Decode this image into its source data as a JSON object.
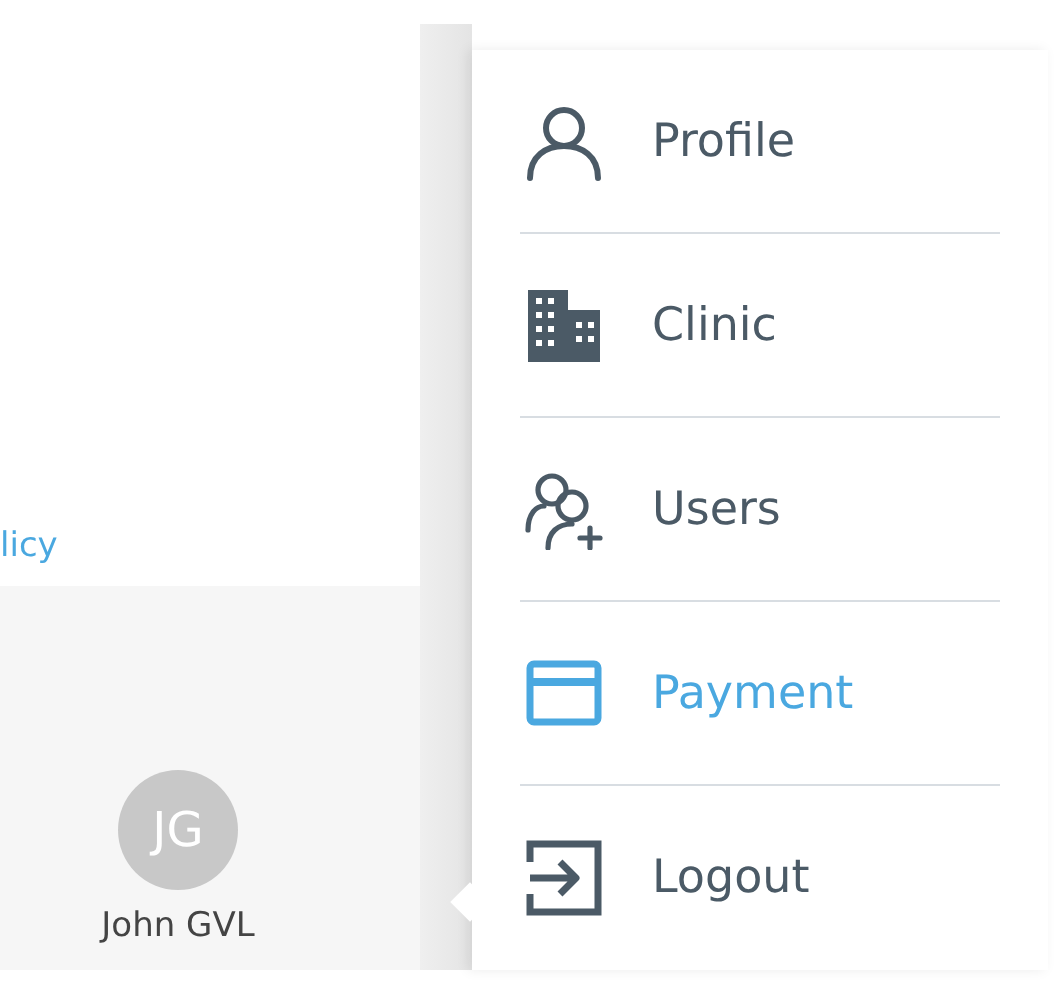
{
  "page": {
    "link": "licy"
  },
  "user": {
    "initials": "JG",
    "name": "John GVL"
  },
  "menu": [
    {
      "label": "Profile",
      "kind": "person",
      "selected": false
    },
    {
      "label": "Clinic",
      "kind": "building",
      "selected": false
    },
    {
      "label": "Users",
      "kind": "users",
      "selected": false
    },
    {
      "label": "Payment",
      "kind": "card",
      "selected": true
    },
    {
      "label": "Logout",
      "kind": "logout",
      "selected": false
    }
  ]
}
